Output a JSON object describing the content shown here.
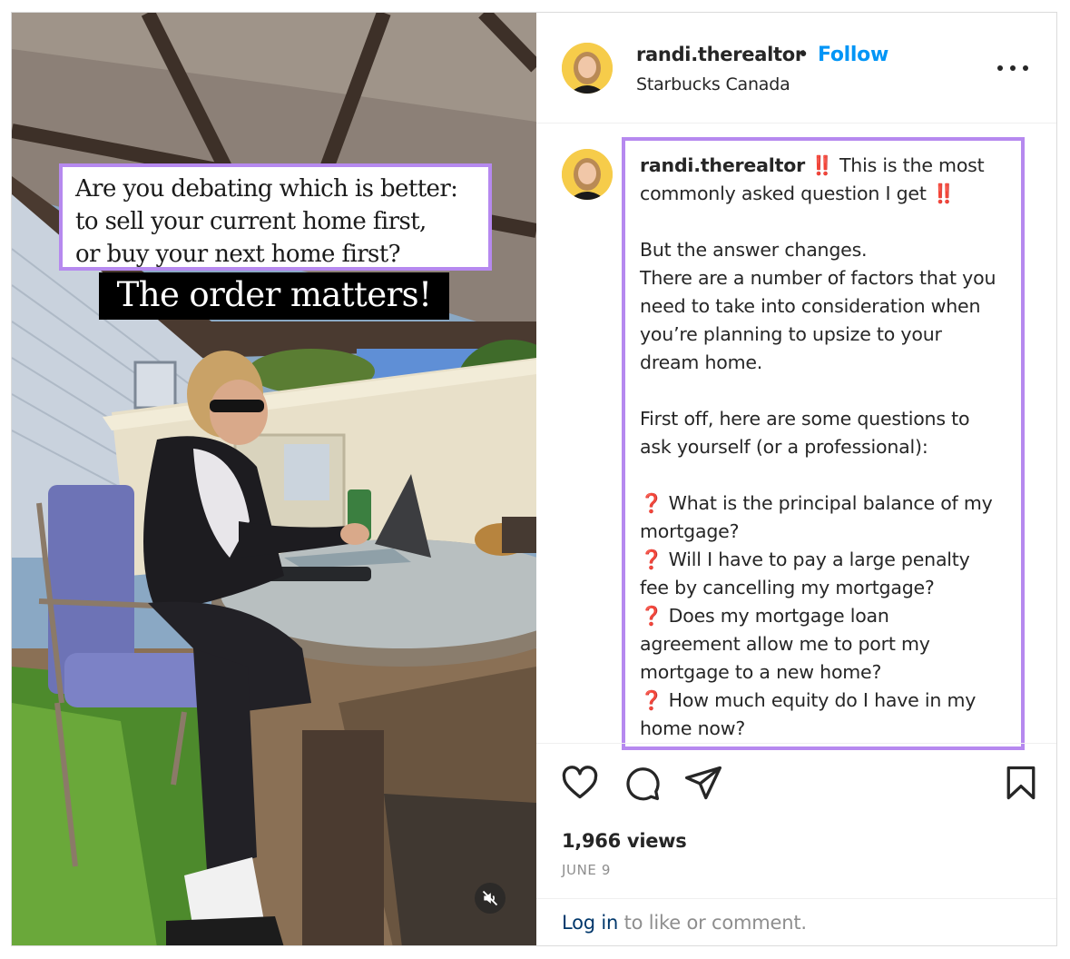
{
  "media": {
    "overlay_question": "Are you debating which is better:\nto sell your current home first,\nor buy your next home first?",
    "overlay_tagline": "The order matters!",
    "mute_icon": "speaker-muted-icon"
  },
  "header": {
    "username": "randi.therealtor",
    "separator": "•",
    "follow_label": "Follow",
    "location": "Starbucks Canada",
    "more_icon": "more-horizontal-icon"
  },
  "caption": {
    "username": "randi.therealtor",
    "emoji_bang": "‼️",
    "emoji_q": "❓",
    "lines": [
      "This is the most",
      "commonly asked question I get",
      "",
      "But the answer changes.",
      "There are a number of factors that you",
      "need to take into consideration when",
      "you’re planning to upsize to your",
      "dream home.",
      "",
      "First off, here are some questions to",
      "ask yourself (or a professional):",
      "",
      "What is the principal balance of my",
      "mortgage?",
      "Will I have to pay a large penalty",
      "fee by cancelling my mortgage?",
      "Does my mortgage loan",
      "agreement allow me to port my",
      "mortgage to a new home?",
      "How much equity do I have in my",
      "home now?"
    ]
  },
  "actions": {
    "like_icon": "heart-icon",
    "comment_icon": "comment-icon",
    "share_icon": "share-icon",
    "save_icon": "bookmark-icon"
  },
  "stats": {
    "views": "1,966 views",
    "date": "JUNE 9"
  },
  "login": {
    "link_text": "Log in",
    "rest_text": " to like or comment."
  },
  "colors": {
    "accent_border": "#b689ef",
    "follow_blue": "#0095f6",
    "link_dark_blue": "#00376b",
    "emoji_red": "#e0245e"
  }
}
